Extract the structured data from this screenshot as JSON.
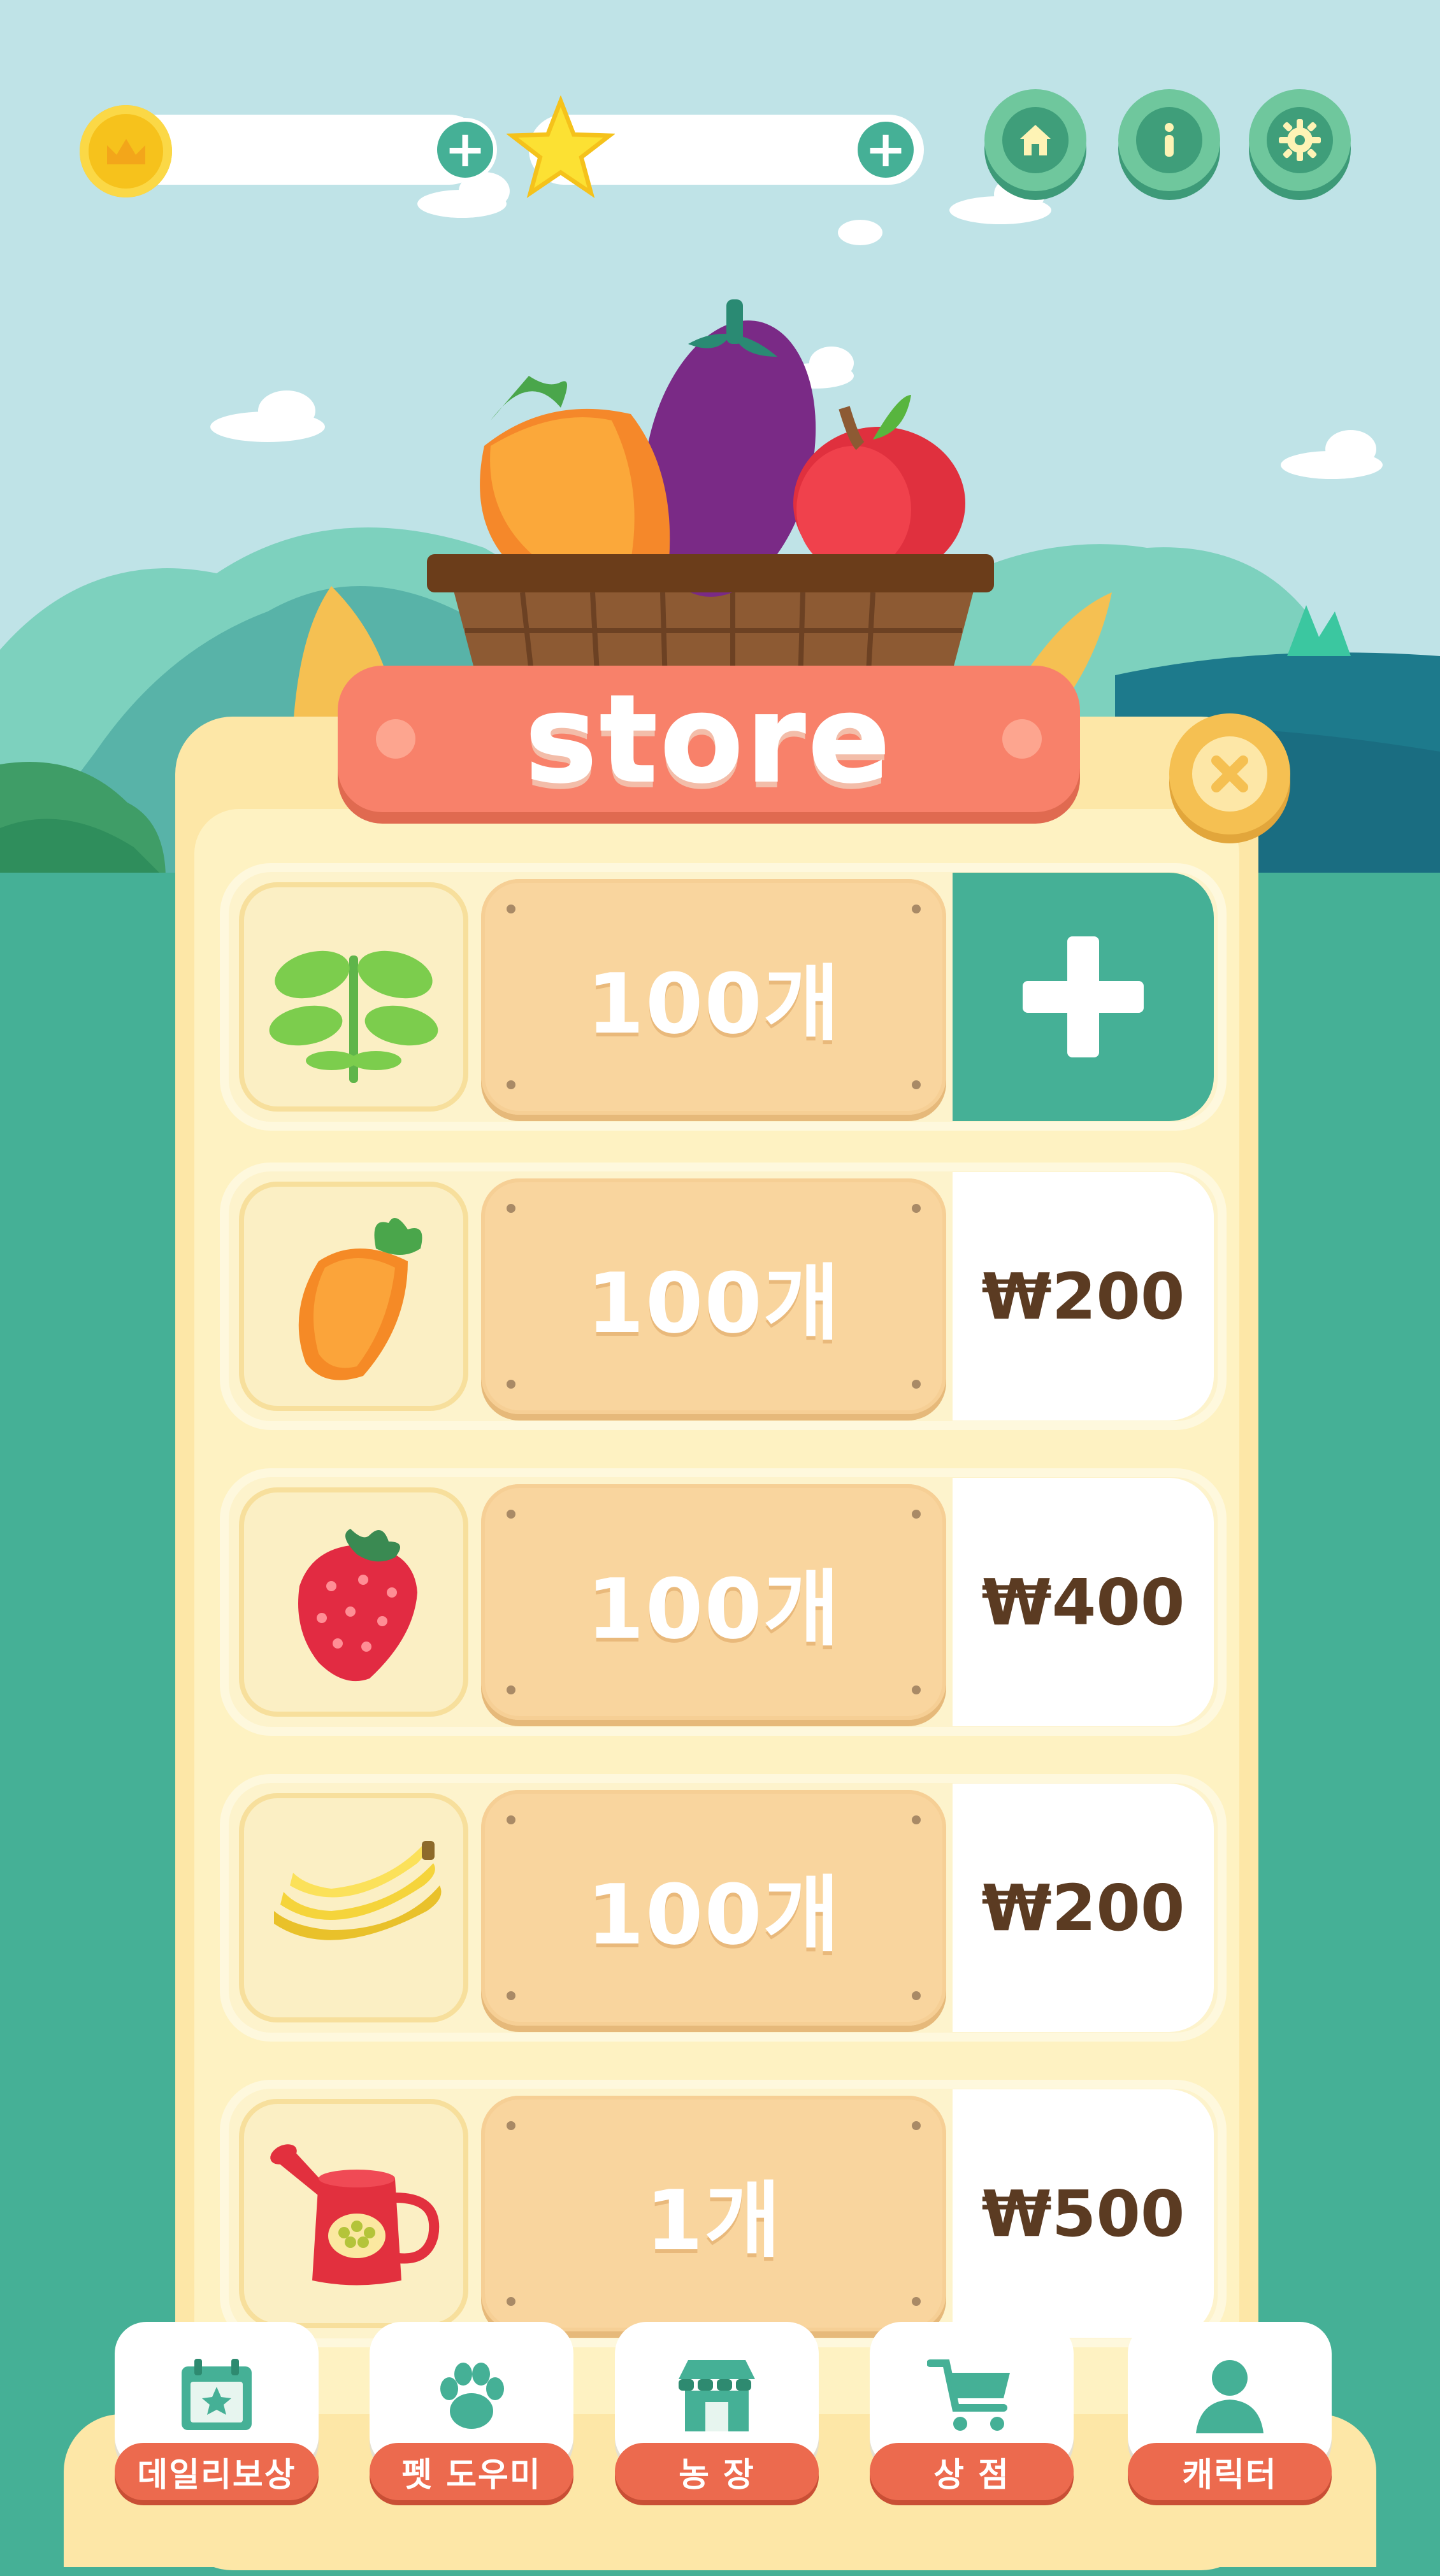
{
  "header": {
    "coin_icon": "crown-coin-icon",
    "star_icon": "star-icon",
    "add_label": "+",
    "buttons": [
      "home-icon",
      "info-icon",
      "settings-icon"
    ]
  },
  "store": {
    "title": "store",
    "close_icon": "close-icon",
    "items": [
      {
        "icon": "sprout-icon",
        "quantity": "100개",
        "price": "",
        "action": "add"
      },
      {
        "icon": "carrot-icon",
        "quantity": "100개",
        "price": "₩200"
      },
      {
        "icon": "strawberry-icon",
        "quantity": "100개",
        "price": "₩400"
      },
      {
        "icon": "banana-icon",
        "quantity": "100개",
        "price": "₩200"
      },
      {
        "icon": "watering-can-icon",
        "quantity": "1개",
        "price": "₩500"
      }
    ]
  },
  "nav": {
    "items": [
      {
        "label": "데일리보상",
        "icon": "calendar-icon"
      },
      {
        "label": "펫 도우미",
        "icon": "paw-icon"
      },
      {
        "label": "농 장",
        "icon": "farm-store-icon"
      },
      {
        "label": "상 점",
        "icon": "cart-icon"
      },
      {
        "label": "캐릭터",
        "icon": "user-icon"
      }
    ]
  },
  "colors": {
    "sky": "#bfe3e7",
    "ground": "#45b096",
    "panel": "#fde7a7",
    "banner": "#f8816a",
    "price_text": "#5b3b22",
    "nav_label": "#ec6a4e"
  }
}
